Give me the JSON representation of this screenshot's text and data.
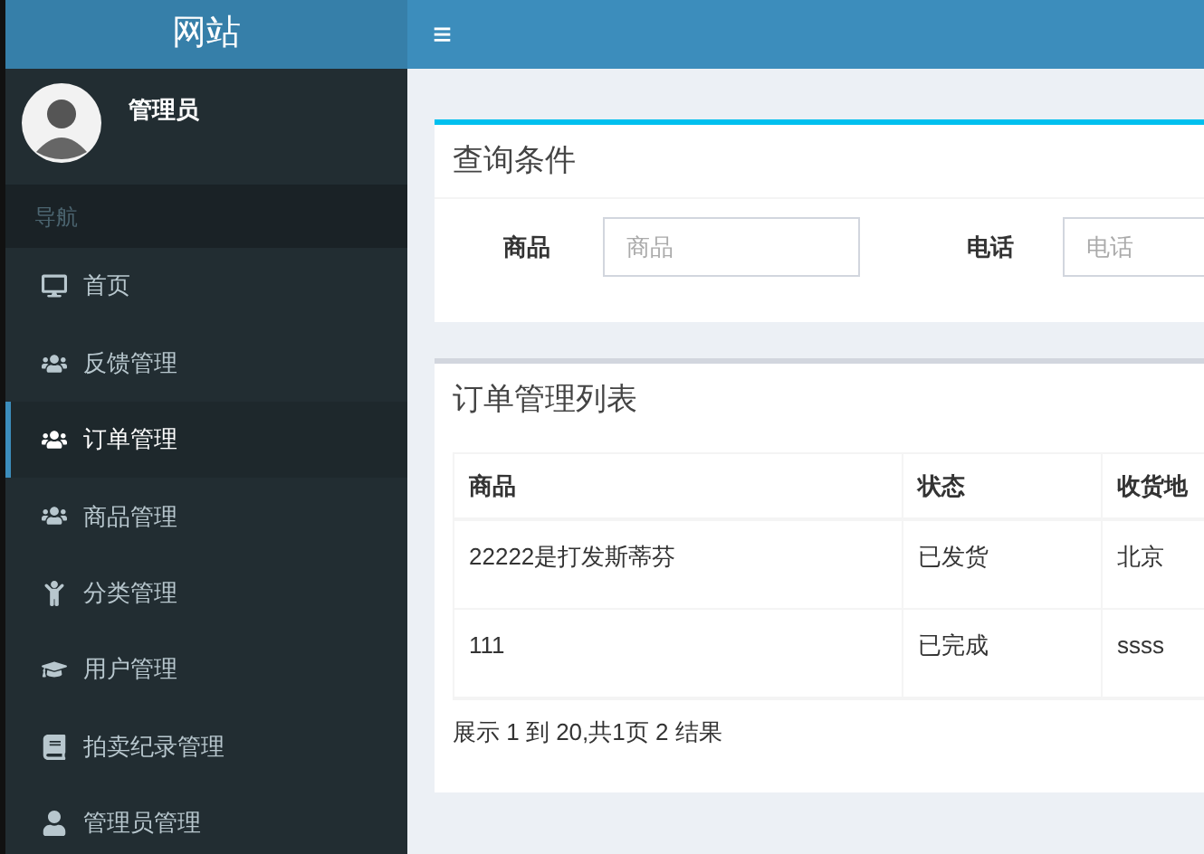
{
  "brand": "网站",
  "user": {
    "name": "管理员"
  },
  "nav_header": "导航",
  "sidebar": {
    "items": [
      {
        "label": "首页",
        "selected": false
      },
      {
        "label": "反馈管理",
        "selected": false
      },
      {
        "label": "订单管理",
        "selected": true
      },
      {
        "label": "商品管理",
        "selected": false
      },
      {
        "label": "分类管理",
        "selected": false
      },
      {
        "label": "用户管理",
        "selected": false
      },
      {
        "label": "拍卖纪录管理",
        "selected": false
      },
      {
        "label": "管理员管理",
        "selected": false
      }
    ]
  },
  "menu_icon": "≡",
  "query": {
    "title": "查询条件",
    "fields": [
      {
        "label": "商品",
        "placeholder": "商品"
      },
      {
        "label": "电话",
        "placeholder": "电话"
      }
    ]
  },
  "table": {
    "title": "订单管理列表",
    "columns": [
      "商品",
      "状态",
      "收货地"
    ],
    "rows": [
      [
        "22222是打发斯蒂芬",
        "已发货",
        "北京"
      ],
      [
        "111",
        "已完成",
        "ssss"
      ]
    ],
    "summary": "展示 1 到 20,共1页 2 结果"
  }
}
